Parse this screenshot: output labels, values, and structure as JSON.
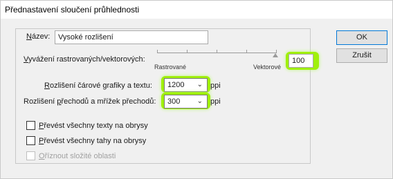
{
  "window": {
    "title": "Přednastavení sloučení průhlednosti"
  },
  "name": {
    "label_u": "N",
    "label_rest": "ázev:",
    "value": "Vysoké rozlišení"
  },
  "balance": {
    "label_u": "V",
    "label_rest": "yvážení rastrovaných/vektorových:",
    "left_label": "Rastrované",
    "right_label": "Vektorové",
    "value": "100"
  },
  "line_art": {
    "label_u": "R",
    "label_rest": "ozlišení čárové grafiky a textu:",
    "value": "1200",
    "unit": "ppi"
  },
  "gradient": {
    "label_pre": "Rozlišení ",
    "label_u": "p",
    "label_rest": "řechodů a mřížek přechodů:",
    "value": "300",
    "unit": "ppi"
  },
  "options": [
    {
      "label_u": "P",
      "label_rest": "řevést všechny texty na obrysy",
      "checked": false,
      "enabled": true
    },
    {
      "label_u": "P",
      "label_rest": "řevést všechny tahy na obrysy",
      "checked": false,
      "enabled": true
    },
    {
      "label_u": "O",
      "label_rest": "říznout složité oblasti",
      "checked": false,
      "enabled": false
    }
  ],
  "buttons": {
    "ok": "OK",
    "cancel": "Zrušit"
  },
  "colors": {
    "highlight": "#9cf000",
    "default_button_border": "#0078d7"
  }
}
